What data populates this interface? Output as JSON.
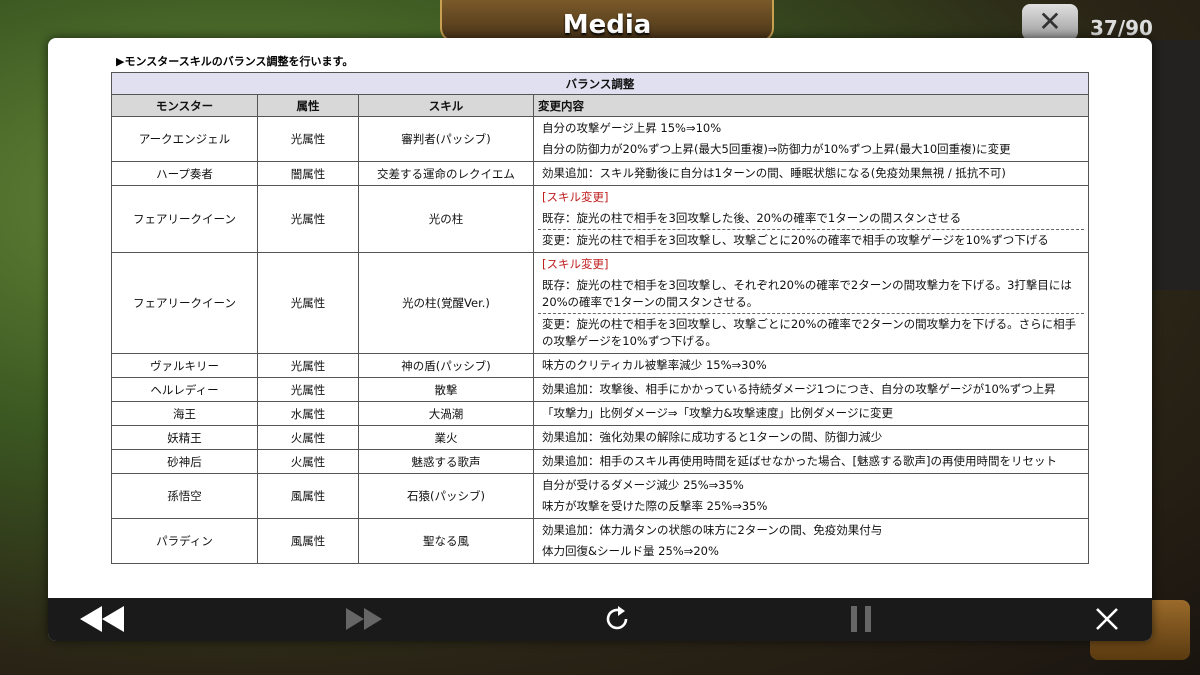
{
  "background": {
    "title": "Media",
    "counter": "37/90"
  },
  "notice": "▶モンスタースキルのバランス調整を行います。",
  "table": {
    "title": "バランス調整",
    "headers": {
      "monster": "モンスター",
      "attribute": "属性",
      "skill": "スキル",
      "change": "変更内容"
    },
    "rows": [
      {
        "monster": "アークエンジェル",
        "attribute": "光属性",
        "skill": "審判者(パッシブ)",
        "lines": [
          {
            "text": "自分の攻撃ゲージ上昇 15%⇒10%"
          },
          {
            "text": "自分の防御力が20%ずつ上昇(最大5回重複)⇒防御力が10%ずつ上昇(最大10回重複)に変更"
          }
        ]
      },
      {
        "monster": "ハープ奏者",
        "attribute": "闇属性",
        "skill": "交差する運命のレクイエム",
        "lines": [
          {
            "text": "効果追加：スキル発動後に自分は1ターンの間、睡眠状態になる(免疫効果無視 / 抵抗不可)"
          }
        ]
      },
      {
        "monster": "フェアリークイーン",
        "attribute": "光属性",
        "skill": "光の柱",
        "lines": [
          {
            "text": "[スキル変更]",
            "red": true
          },
          {
            "text": "既存：旋光の柱で相手を3回攻撃した後、20%の確率で1ターンの間スタンさせる"
          },
          {
            "text": "変更：旋光の柱で相手を3回攻撃し、攻撃ごとに20%の確率で相手の攻撃ゲージを10%ずつ下げる",
            "dashed": true
          }
        ]
      },
      {
        "monster": "フェアリークイーン",
        "attribute": "光属性",
        "skill": "光の柱(覚醒Ver.)",
        "lines": [
          {
            "text": "[スキル変更]",
            "red": true
          },
          {
            "text": "既存：旋光の柱で相手を3回攻撃し、それぞれ20%の確率で2ターンの間攻撃力を下げる。3打撃目には20%の確率で1ターンの間スタンさせる。"
          },
          {
            "text": "変更：旋光の柱で相手を3回攻撃し、攻撃ごとに20%の確率で2ターンの間攻撃力を下げる。さらに相手の攻撃ゲージを10%ずつ下げる。",
            "dashed": true
          }
        ]
      },
      {
        "monster": "ヴァルキリー",
        "attribute": "光属性",
        "skill": "神の盾(パッシブ)",
        "lines": [
          {
            "text": "味方のクリティカル被撃率減少 15%⇒30%"
          }
        ]
      },
      {
        "monster": "ヘルレディー",
        "attribute": "光属性",
        "skill": "散撃",
        "lines": [
          {
            "text": "効果追加：攻撃後、相手にかかっている持続ダメージ1つにつき、自分の攻撃ゲージが10%ずつ上昇"
          }
        ]
      },
      {
        "monster": "海王",
        "attribute": "水属性",
        "skill": "大渦潮",
        "lines": [
          {
            "text": "「攻撃力」比例ダメージ⇒「攻撃力&攻撃速度」比例ダメージに変更"
          }
        ]
      },
      {
        "monster": "妖精王",
        "attribute": "火属性",
        "skill": "業火",
        "lines": [
          {
            "text": "効果追加：強化効果の解除に成功すると1ターンの間、防御力減少"
          }
        ]
      },
      {
        "monster": "砂神后",
        "attribute": "火属性",
        "skill": "魅惑する歌声",
        "lines": [
          {
            "text": "効果追加：相手のスキル再使用時間を延ばせなかった場合、[魅惑する歌声]の再使用時間をリセット"
          }
        ]
      },
      {
        "monster": "孫悟空",
        "attribute": "風属性",
        "skill": "石猿(パッシブ)",
        "lines": [
          {
            "text": "自分が受けるダメージ減少 25%⇒35%"
          },
          {
            "text": "味方が攻撃を受けた際の反撃率 25%⇒35%"
          }
        ]
      },
      {
        "monster": "パラディン",
        "attribute": "風属性",
        "skill": "聖なる風",
        "lines": [
          {
            "text": "効果追加：体力満タンの状態の味方に2ターンの間、免疫効果付与"
          },
          {
            "text": "体力回復&シールド量 25%⇒20%"
          }
        ]
      }
    ]
  },
  "controls": {
    "rewind": "rewind-icon",
    "fast_forward": "fast-forward-icon",
    "reload": "reload-icon",
    "pause": "pause-icon",
    "close": "close-icon"
  }
}
